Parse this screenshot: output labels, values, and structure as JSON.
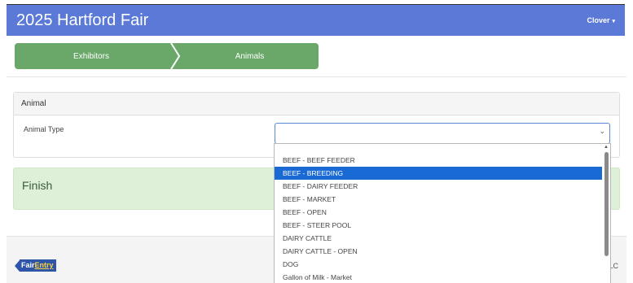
{
  "app": {
    "title": "2025 Hartford Fair",
    "user_menu": "Clover",
    "user_caret": "▾"
  },
  "steps": [
    {
      "label": "Exhibitors"
    },
    {
      "label": "Animals"
    }
  ],
  "panel": {
    "heading": "Animal",
    "field_label": "Animal Type",
    "select_value": "",
    "select_chevron": "⌄"
  },
  "finish": {
    "label": "Finish"
  },
  "dropdown": {
    "options": [
      "BEEF - BEEF FEEDER",
      "BEEF - BREEDING",
      "BEEF - DAIRY FEEDER",
      "BEEF - MARKET",
      "BEEF - OPEN",
      "BEEF - STEER POOL",
      "DAIRY CATTLE",
      "DAIRY CATTLE - OPEN",
      "DOG",
      "Gallon of Milk - Market"
    ],
    "highlighted_option": "BEEF - BREEDING"
  },
  "footer": {
    "logo_left": "Fair",
    "logo_right": "Entry",
    "right_text": "LC"
  },
  "colors": {
    "header": "#5b79d6",
    "step_green": "#6aa86a",
    "finish_bg": "#dff0d8",
    "highlight": "#1a6ad6"
  }
}
